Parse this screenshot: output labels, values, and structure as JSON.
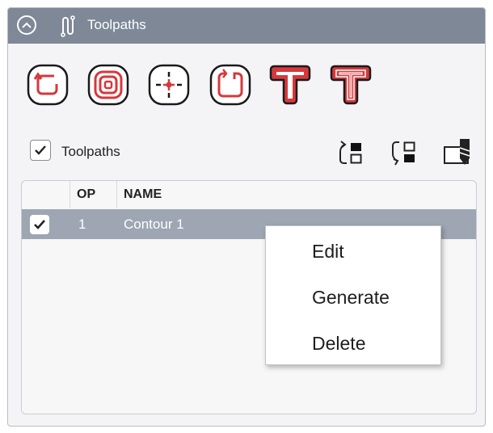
{
  "header": {
    "title": "Toolpaths",
    "collapse_icon": "chevron-up-circle-icon",
    "title_icon": "toolpath-icon"
  },
  "toolbar": {
    "tools": [
      {
        "name": "pocket-tool",
        "icon": "pocket-clearance-icon"
      },
      {
        "name": "offset-pocket-tool",
        "icon": "concentric-offset-icon"
      },
      {
        "name": "drill-tool",
        "icon": "drill-point-icon"
      },
      {
        "name": "profile-tool",
        "icon": "profile-contour-icon"
      },
      {
        "name": "text-engrave-tool",
        "icon": "text-engrave-icon"
      },
      {
        "name": "text-pocket-tool",
        "icon": "text-pocket-icon"
      }
    ]
  },
  "filter": {
    "checked": true,
    "label": "Toolpaths"
  },
  "actions": [
    {
      "name": "move-up-button",
      "icon": "move-up-icon"
    },
    {
      "name": "move-down-button",
      "icon": "move-down-icon"
    },
    {
      "name": "tool-library-button",
      "icon": "tool-library-icon"
    }
  ],
  "table": {
    "columns": [
      "",
      "OP",
      "NAME"
    ],
    "rows": [
      {
        "checked": true,
        "op": "1",
        "name": "Contour 1",
        "selected": true
      }
    ]
  },
  "context_menu": {
    "items": [
      "Edit",
      "Generate",
      "Delete"
    ]
  },
  "colors": {
    "header_bg": "#7e8896",
    "selected_row": "#9da6b2",
    "tool_red": "#d6383c"
  }
}
